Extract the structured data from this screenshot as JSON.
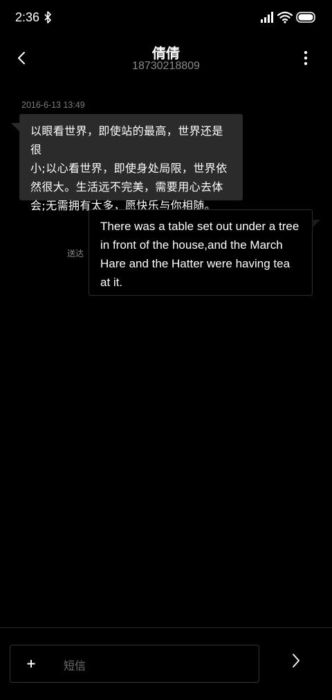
{
  "status_bar": {
    "time": "2:36",
    "icons": [
      "bluetooth-icon",
      "signal-icon",
      "wifi-icon",
      "battery-icon"
    ]
  },
  "header": {
    "contact_name": "倩倩",
    "phone_number": "18730218809",
    "back_icon": "chevron-left-icon",
    "more_icon": "more-vertical-icon"
  },
  "conversation": {
    "timestamp": "2016-6-13 13:49",
    "messages": [
      {
        "direction": "received",
        "lines": [
          "以眼看世界，即使站的最高，世界还是很",
          "小;以心看世界，即使身处局限，世界依",
          "然很大。生活远不完美，需要用心去体",
          "会;无需拥有太多，愿快乐与你相随。"
        ]
      },
      {
        "direction": "sent",
        "status": "送达",
        "lines": [
          "There was a table set out under a tree",
          "in front of the house,and the March",
          "Hare and the Hatter were having tea",
          "at it."
        ]
      }
    ]
  },
  "composer": {
    "attach_label": "+",
    "placeholder": "短信",
    "value": "",
    "send_icon": "chevron-right-icon"
  },
  "colors": {
    "background": "#000000",
    "received_bubble": "#2b2b2b",
    "sent_bubble_border": "#2e2e2e",
    "secondary_text": "#8a8a8a"
  }
}
